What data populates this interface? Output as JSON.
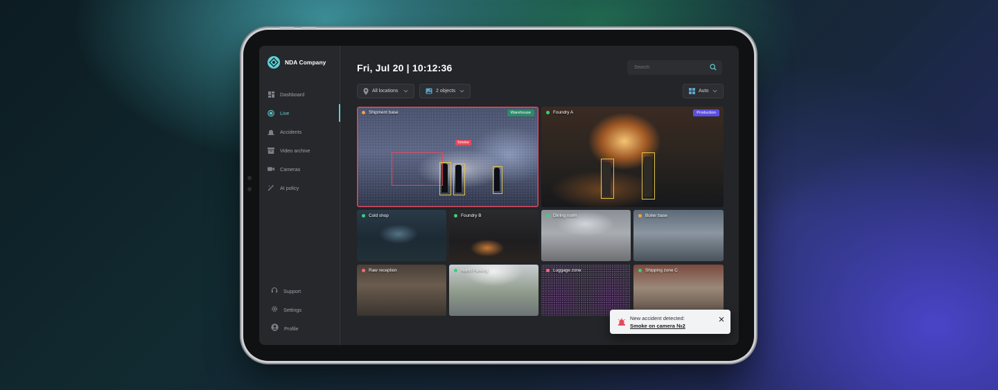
{
  "brand": {
    "name": "NDA Company"
  },
  "nav": [
    {
      "label": "Dashboard",
      "icon": "dashboard-icon",
      "active": false
    },
    {
      "label": "Live",
      "icon": "live-icon",
      "active": true
    },
    {
      "label": "Accidents",
      "icon": "alarm-icon",
      "active": false
    },
    {
      "label": "Video archive",
      "icon": "archive-icon",
      "active": false
    },
    {
      "label": "Cameras",
      "icon": "camera-icon",
      "active": false
    },
    {
      "label": "AI policy",
      "icon": "ai-policy-icon",
      "active": false
    }
  ],
  "bottom_nav": [
    {
      "label": "Support",
      "icon": "headset-icon"
    },
    {
      "label": "Settings",
      "icon": "gear-icon"
    },
    {
      "label": "Profile",
      "icon": "profile-icon"
    }
  ],
  "header": {
    "datetime": "Fri, Jul 20 | 10:12:36",
    "search_placeholder": "Search"
  },
  "filters": {
    "location": "All locations",
    "objects": "2 objects",
    "layout": "Auto"
  },
  "cameras_main": [
    {
      "name": "Shipment base",
      "status_color": "#f0a14b",
      "tag": "Warehouse",
      "tag_color": "#2d8a66",
      "alert": true,
      "detection_label": "Smoke"
    },
    {
      "name": "Foundry A",
      "status_color": "#3ccf7c",
      "tag": "Production",
      "tag_color": "#5b4fe0",
      "alert": false
    }
  ],
  "cameras_small": [
    {
      "name": "Cold shop",
      "status_color": "#3ccf7c"
    },
    {
      "name": "Foundry B",
      "status_color": "#3ccf7c"
    },
    {
      "name": "Dining room",
      "status_color": "#3ccf7c"
    },
    {
      "name": "Boiler base",
      "status_color": "#f0a14b"
    },
    {
      "name": "Raw reception",
      "status_color": "#f06b7d"
    },
    {
      "name": "North Parking",
      "status_color": "#3ccf7c"
    },
    {
      "name": "Luggage zone",
      "status_color": "#f06b7d"
    },
    {
      "name": "Shipping zone C",
      "status_color": "#3ccf7c"
    }
  ],
  "toast": {
    "title": "New accident detected:",
    "link": "Smoke on camera №2"
  },
  "colors": {
    "accent": "#5fd1d6",
    "alert": "#e24a5e",
    "bbox": "#e2c44d"
  }
}
